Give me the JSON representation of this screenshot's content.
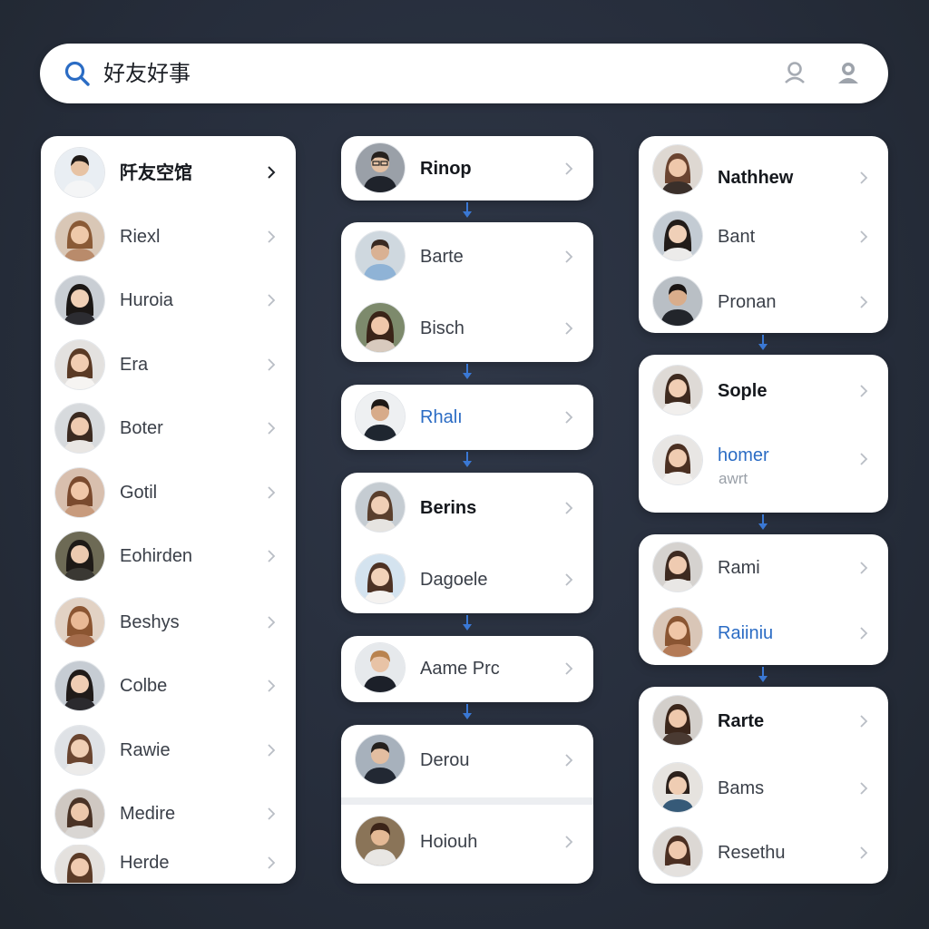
{
  "search": {
    "query": "好友好事"
  },
  "colors": {
    "accent": "#2b6cc4",
    "background": "#262d3b",
    "card": "#ffffff"
  },
  "icons": {
    "search": "search-icon",
    "sb1": "user-outline-icon",
    "sb2": "user-circle-icon",
    "chevron": "chevron-right-icon",
    "arrow": "arrow-down-icon"
  },
  "columns": [
    {
      "cards": [
        {
          "rows": [
            {
              "name": "阡友空馆",
              "style": "bold"
            },
            {
              "name": "Riexl"
            },
            {
              "name": "Huroia"
            },
            {
              "name": "Era"
            },
            {
              "name": "Boter"
            },
            {
              "name": "Gotil"
            },
            {
              "name": "Eohirden"
            },
            {
              "name": "Beshys"
            },
            {
              "name": "Colbe"
            },
            {
              "name": "Rawie"
            },
            {
              "name": "Medire"
            },
            {
              "name": "Herde"
            }
          ]
        }
      ]
    },
    {
      "cards": [
        {
          "rows": [
            {
              "name": "Rinop",
              "style": "bold"
            }
          ]
        },
        {
          "rows": [
            {
              "name": "Barte"
            },
            {
              "name": "Bisch"
            }
          ]
        },
        {
          "rows": [
            {
              "name": "Rhalı",
              "style": "blue"
            }
          ]
        },
        {
          "rows": [
            {
              "name": "Berins",
              "style": "bold"
            },
            {
              "name": "Dagoele"
            }
          ]
        },
        {
          "rows": [
            {
              "name": "Aame Prc"
            }
          ]
        },
        {
          "rows": [
            {
              "name": "Derou"
            },
            {
              "name": "Hoiouh"
            }
          ]
        }
      ]
    },
    {
      "cards": [
        {
          "rows": [
            {
              "name": "Nathhew",
              "style": "bold"
            },
            {
              "name": "Bant"
            },
            {
              "name": "Pronan"
            }
          ]
        },
        {
          "rows": [
            {
              "name": "Sople",
              "style": "bold"
            },
            {
              "name": "homer",
              "style": "blue",
              "sub": "awrt"
            }
          ]
        },
        {
          "rows": [
            {
              "name": "Rami"
            },
            {
              "name": "Raiiniu",
              "style": "blue"
            }
          ]
        },
        {
          "rows": [
            {
              "name": "Rarte",
              "style": "bold"
            },
            {
              "name": "Bams"
            },
            {
              "name": "Resethu"
            }
          ]
        }
      ]
    }
  ]
}
